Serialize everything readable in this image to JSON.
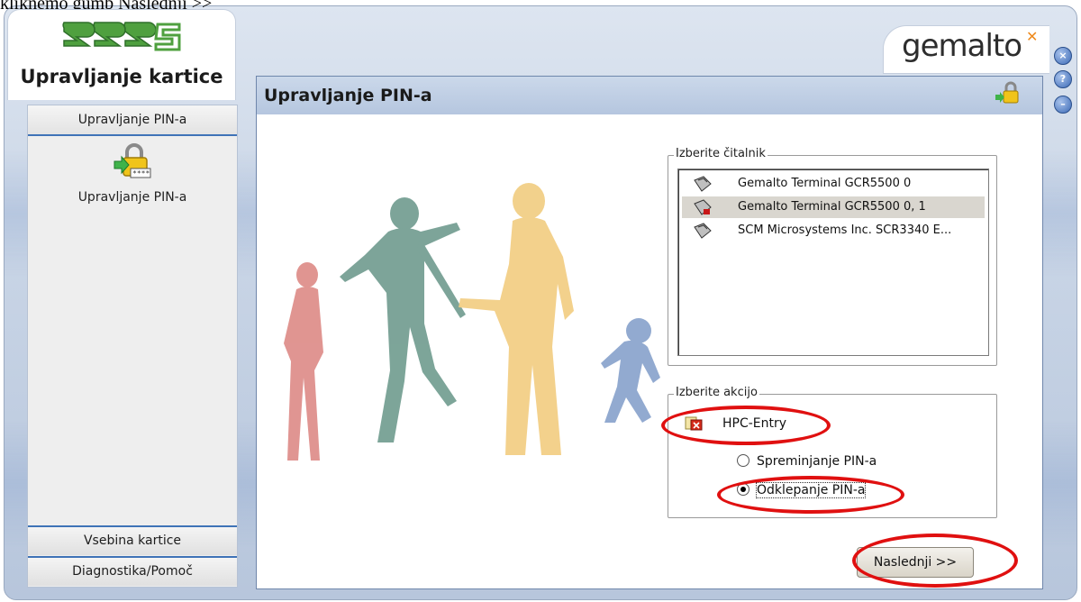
{
  "document_caption": "kliknemo gumb Naslednji >>",
  "left": {
    "app_title": "Upravljanje kartice",
    "section_header": "Upravljanje PIN-a",
    "nav_item_label": "Upravljanje PIN-a",
    "bottom_tabs": [
      "Vsebina kartice",
      "Diagnostika/Pomoč"
    ]
  },
  "brand": "gemalto",
  "window_buttons": [
    "×",
    "?",
    "–"
  ],
  "main": {
    "title": "Upravljanje PIN-a",
    "reader_group_label": "Izberite čitalnik",
    "readers": [
      {
        "name": "Gemalto Terminal GCR5500 0",
        "selected": false
      },
      {
        "name": "Gemalto Terminal GCR5500 0, 1",
        "selected": true
      },
      {
        "name": "SCM Microsystems Inc. SCR3340 E...",
        "selected": false
      }
    ],
    "action_group_label": "Izberite akcijo",
    "card_label": "HPC-Entry",
    "actions": [
      {
        "label": "Spreminjanje PIN-a",
        "selected": false
      },
      {
        "label": "Odklepanje PIN-a",
        "selected": true
      }
    ],
    "next_button": "Naslednji >>"
  },
  "colors": {
    "accent": "#3f73b7",
    "highlight_oval": "#e01010",
    "header_bg": "#b5c6df"
  }
}
